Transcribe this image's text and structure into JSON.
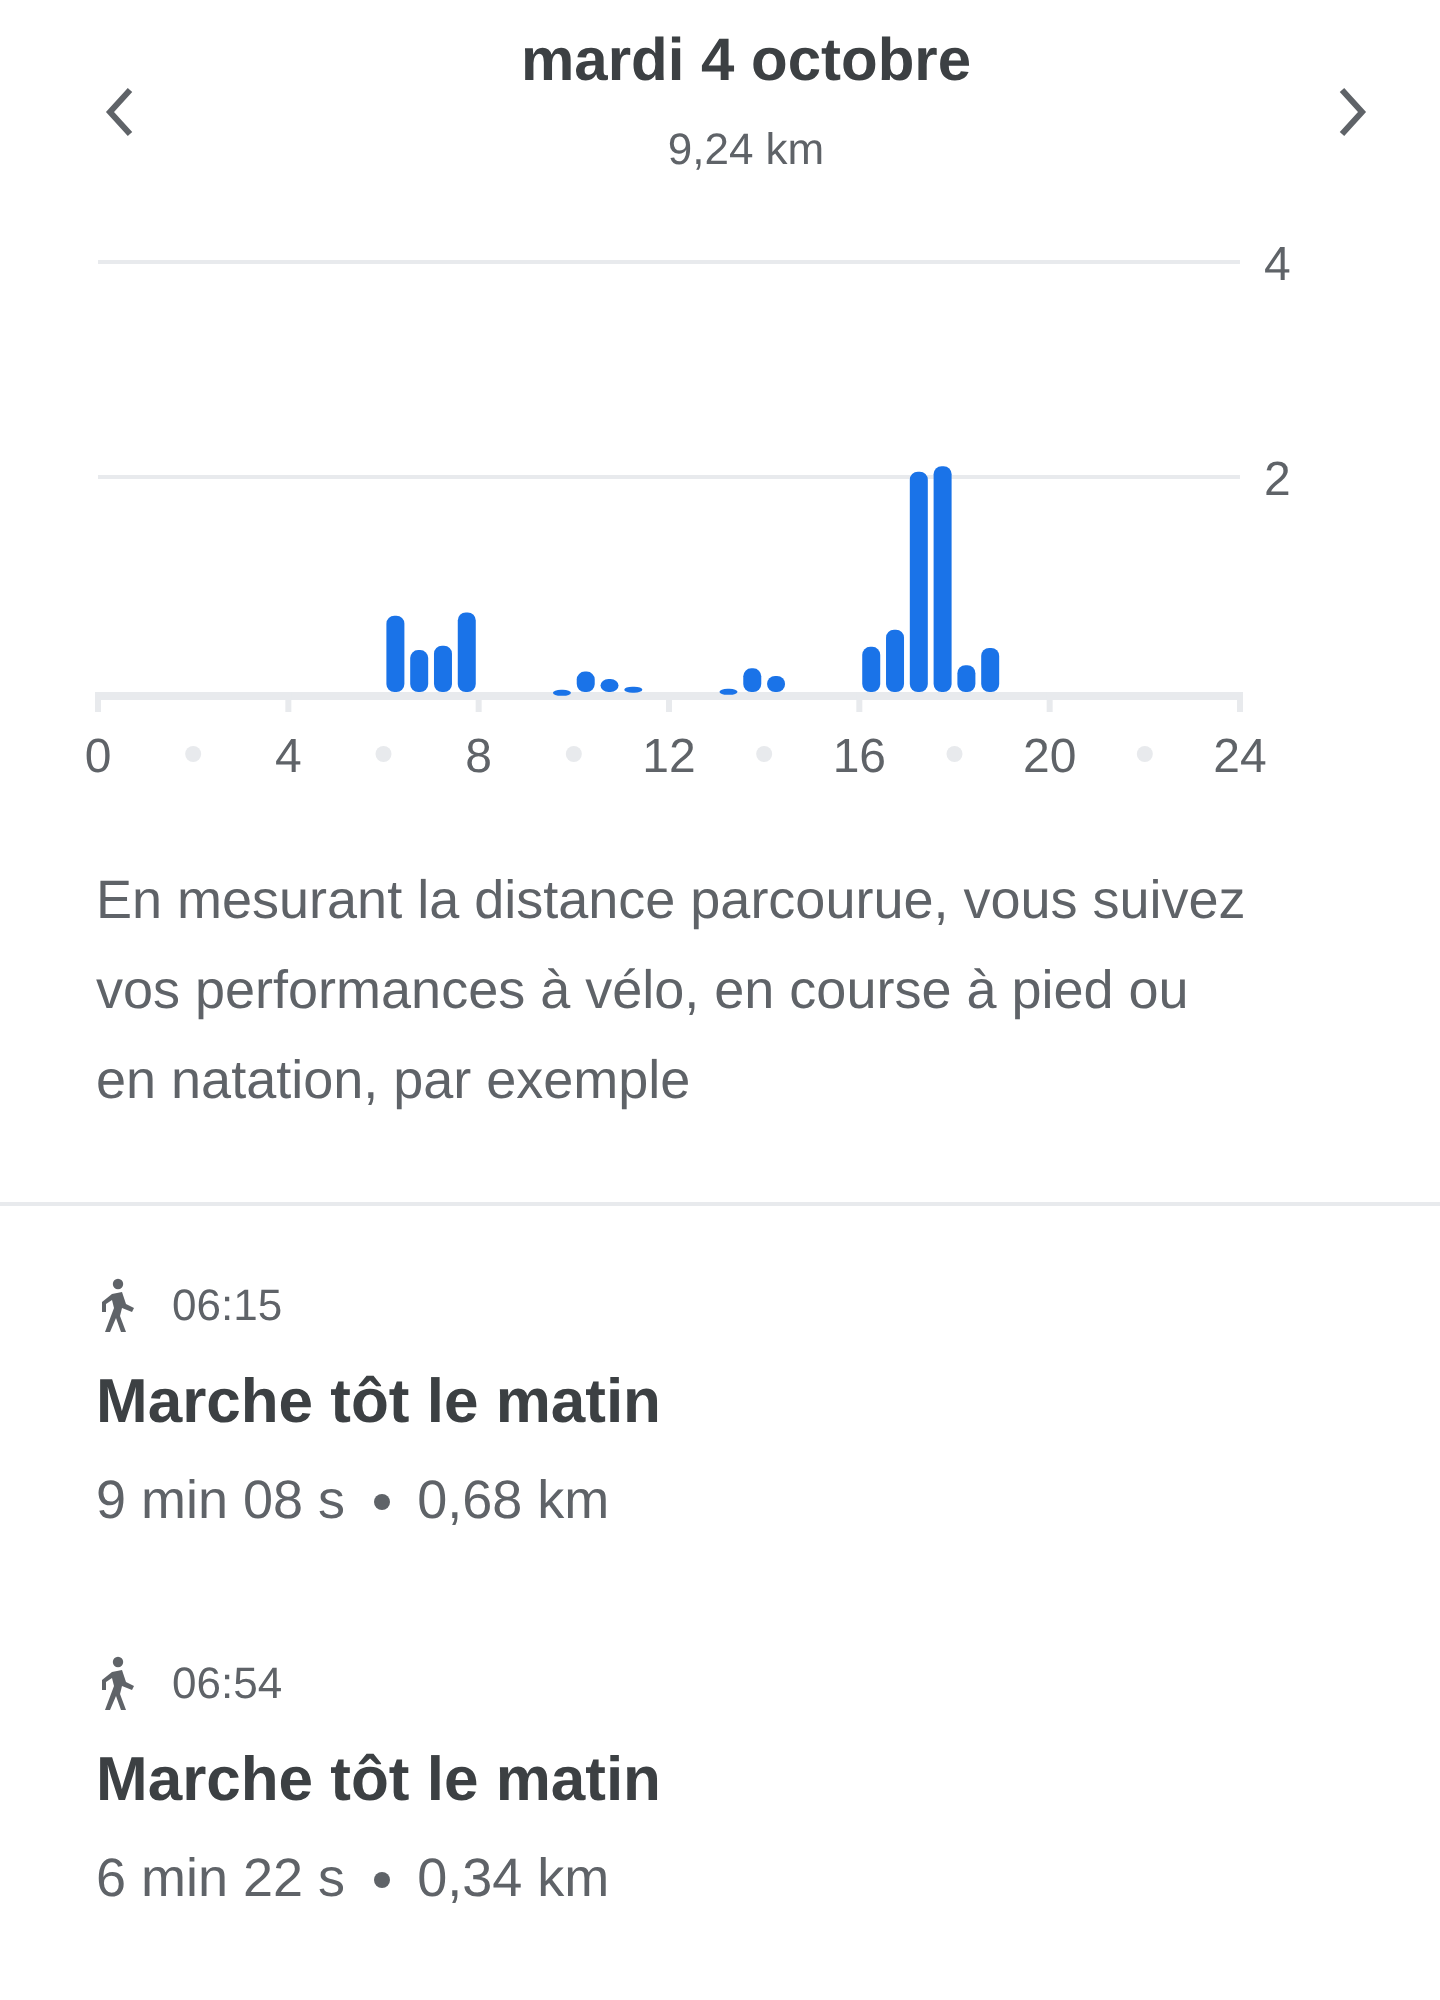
{
  "header": {
    "title": "mardi 4 octobre",
    "subtitle": "9,24 km"
  },
  "chart": {
    "chart_data": {
      "type": "bar",
      "x": [
        6.25,
        6.75,
        7.25,
        7.75,
        9.75,
        10.25,
        10.75,
        11.25,
        13.25,
        13.75,
        14.25,
        16.25,
        16.75,
        17.25,
        17.75,
        18.25,
        18.75
      ],
      "values": [
        0.71,
        0.39,
        0.43,
        0.74,
        0.02,
        0.19,
        0.12,
        0.05,
        0.03,
        0.22,
        0.15,
        0.42,
        0.58,
        2.05,
        2.1,
        0.25,
        0.41
      ],
      "xlim": [
        0,
        24
      ],
      "ylim": [
        0,
        4
      ],
      "xticks": [
        0,
        4,
        8,
        12,
        16,
        20,
        24
      ],
      "yticks": [
        2,
        4
      ]
    }
  },
  "description": "En mesurant la distance parcourue, vous suivez vos performances à vélo, en course à pied ou en natation, par exemple",
  "activities": [
    {
      "time": "06:15",
      "title": "Marche tôt le matin",
      "duration": "9 min 08 s",
      "distance": "0,68 km"
    },
    {
      "time": "06:54",
      "title": "Marche tôt le matin",
      "duration": "6 min 22 s",
      "distance": "0,34 km"
    }
  ]
}
